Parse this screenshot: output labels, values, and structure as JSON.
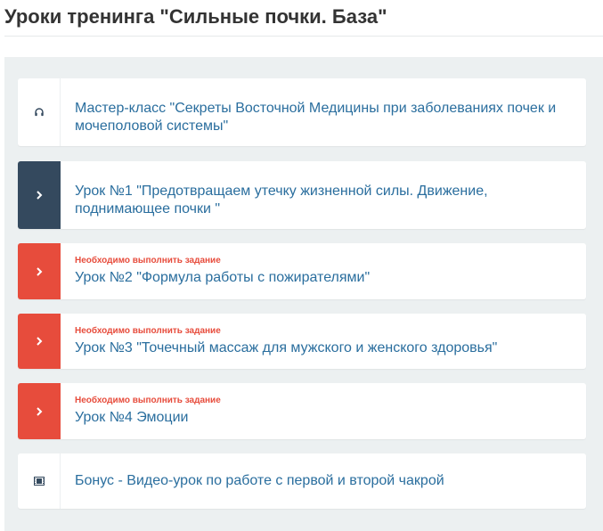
{
  "page": {
    "title": "Уроки тренинга \"Сильные почки. База\""
  },
  "colors": {
    "active": "#34495e",
    "todo": "#e74c3c",
    "link": "#2a6e9e",
    "panel": "#ecf0f1"
  },
  "lessons": [
    {
      "title": "Мастер-класс \"Секреты Восточной Медицины при заболеваниях почек и мочеполовой системы\"",
      "icon": "headphones-icon",
      "status": "default"
    },
    {
      "title": "Урок №1 \"Предотвращаем утечку жизненной силы. Движение, поднимающее почки \"",
      "icon": "chevron-right-icon",
      "status": "active"
    },
    {
      "note": "Необходимо выполнить задание",
      "title": "Урок №2 \"Формула работы с пожирателями\"",
      "icon": "chevron-right-icon",
      "status": "todo"
    },
    {
      "note": "Необходимо выполнить задание",
      "title": "Урок №3 \"Точечный массаж для мужского и женского здоровья\"",
      "icon": "chevron-right-icon",
      "status": "todo"
    },
    {
      "note": "Необходимо выполнить задание",
      "title": "Урок №4 Эмоции",
      "icon": "chevron-right-icon",
      "status": "todo"
    },
    {
      "title": "Бонус - Видео-урок по работе с первой и второй чакрой",
      "icon": "film-icon",
      "status": "default"
    }
  ]
}
